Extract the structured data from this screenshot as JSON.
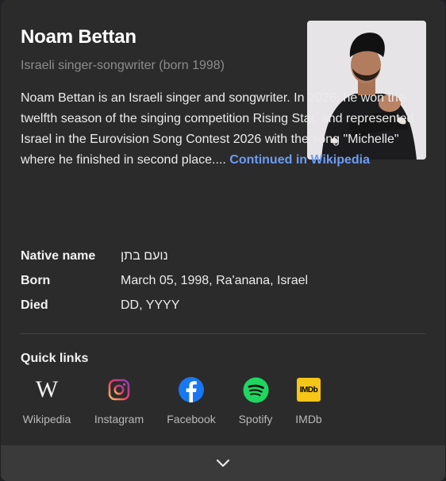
{
  "entity": {
    "name": "Noam Bettan",
    "subtitle": "Israeli singer-songwriter (born 1998)",
    "description": "Noam Bettan is an Israeli singer and songwriter. In 2026, he won the twelfth season of the singing competition Rising Star, and represented Israel in the Eurovision Song Contest 2026 with the song \"Michelle\" where he finished in second place.... ",
    "source_link": "Continued in Wikipedia"
  },
  "facts": [
    {
      "label": "Native name",
      "value": "נועם בתן"
    },
    {
      "label": "Born",
      "value": "March 05, 1998, Ra'anana, Israel"
    },
    {
      "label": "Died",
      "value": "DD, YYYY"
    }
  ],
  "quick_links": {
    "title": "Quick links",
    "items": [
      {
        "label": "Wikipedia",
        "icon": "wikipedia-icon"
      },
      {
        "label": "Instagram",
        "icon": "instagram-icon"
      },
      {
        "label": "Facebook",
        "icon": "facebook-icon"
      },
      {
        "label": "Spotify",
        "icon": "spotify-icon"
      },
      {
        "label": "IMDb",
        "icon": "imdb-icon"
      }
    ]
  },
  "expand": {
    "icon": "chevron-down-icon"
  },
  "colors": {
    "card_bg": "#2b2b2b",
    "link": "#6b9cf5",
    "facebook": "#1877f2",
    "spotify": "#1ed760",
    "imdb": "#f5c518"
  }
}
